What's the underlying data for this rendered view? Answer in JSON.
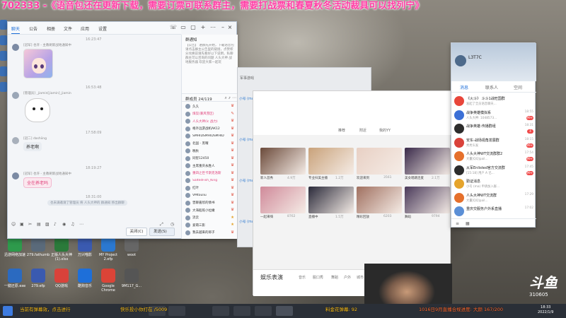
{
  "overlay": {
    "banner": "702333 -《语音包还在更新下载，需要订票可联系群主，需要打战票和春夏秋冬活动裁具可以找列宁》"
  },
  "qq_window": {
    "tabs": [
      "聊天",
      "公告",
      "相册",
      "文件",
      "应用",
      "设置"
    ],
    "messages": [
      {
        "time": "16:23:47",
        "sender": "[冠军] 也许 - 主教刷新战地通知中",
        "type": "sticker-anime"
      },
      {
        "time": "16:53:48",
        "sender": "[管理员] _jiamin[jiamin]_jiamin",
        "type": "sticker-bun"
      },
      {
        "time": "17:58:09",
        "sender": "[冠二] dashiing",
        "text": "养老啊"
      },
      {
        "time": "18:19:27",
        "sender": "[冠军] 也许 - 主教刷新战地通知中",
        "text": "全在养老吗"
      }
    ],
    "sys_time": "18:31:00",
    "system_notice": "也未满邀请了管理员 将 人头大神的 群通知 移出群聊",
    "close_label": "关闭(C)",
    "send_label": "发送(S)",
    "notice_title": "群通知",
    "notice_text": "【公告】 进群先开始，下载语音包请点击群主公告里的链接，点赞积分兑换前请先看好以下说明，私聊群主可以咨询的问题 人头大神 战地服务器 欢迎大家一起玩",
    "members_title": "群成员 24/119",
    "members": [
      {
        "name": "久久",
        "flag": "♛",
        "color": "#333"
      },
      {
        "name": "煤炭(暴风雪区)",
        "flag": "✎",
        "color": "#e0407a"
      },
      {
        "name": "人头大神(lc 战力)",
        "flag": "♛",
        "color": "#e0407a"
      },
      {
        "name": "格外远游战机AK12",
        "flag": "♛",
        "color": "#333"
      },
      {
        "name": "SMHIDSMHIDSMHID",
        "flag": "♛",
        "color": "#333"
      },
      {
        "name": "北国 - 黑曜",
        "flag": "♛",
        "color": "#333"
      },
      {
        "name": "晚秋",
        "flag": "♛",
        "color": "#333"
      },
      {
        "name": "同智12450",
        "flag": "♛",
        "color": "#333"
      },
      {
        "name": "主席重庆永胜人",
        "flag": "♛",
        "color": "#333"
      },
      {
        "name": "重四之巨卡斯克洛斯",
        "flag": "♛",
        "color": "#e0407a"
      },
      {
        "name": "SaltedFish_King",
        "flag": "♛",
        "color": "#e0407a"
      },
      {
        "name": "红叶",
        "flag": "♛",
        "color": "#333"
      },
      {
        "name": "VMtouliu",
        "flag": "♛",
        "color": "#333"
      },
      {
        "name": "曾聊嘉欣的情书",
        "flag": "♛",
        "color": "#333"
      },
      {
        "name": "大海船舵小拉嫩",
        "flag": "♛",
        "color": "#333"
      },
      {
        "name": "流云",
        "flag": "★",
        "color": "#333"
      },
      {
        "name": "爱萌三影",
        "flag": "★",
        "color": "#333"
      },
      {
        "name": "我去越来的郎子",
        "flag": "♛",
        "color": "#333"
      }
    ]
  },
  "mid_window": {
    "title": "军事游戏",
    "rows": [
      {
        "name": "小号 (ma)",
        "text": "申请加入群 人头大神BF无损群",
        "detail": "群号: 这是一个什么群? 答案: 战争游戏 人头大神",
        "status": "由于管理员处理"
      },
      {
        "name": "小号 (ma)",
        "text": "申请加入群 人头大神BF无损群",
        "detail": "群号: 这是一个什么群? 答案: 人头大神 BF 交流群",
        "status": "由于管理员处理"
      },
      {
        "name": "小号 (ma)",
        "text": "申请加入群 人头大神Xmod (示范)",
        "detail": "群号: 这是一个什么群? 答案: 从军乐营群",
        "status": "由于管理员处理"
      },
      {
        "name": "小号 (ma)",
        "text": "申请加入群 人头大神BF无损群",
        "detail": "",
        "status": ""
      }
    ]
  },
  "video_site": {
    "tabs": [
      "推荐",
      "附近",
      "我的YY"
    ],
    "thumbs": [
      {
        "caption": "新人首秀",
        "views": "4.9万"
      },
      {
        "caption": "专业扫美主播",
        "views": "1.2万"
      },
      {
        "caption": "欢迎来到",
        "views": "3561"
      },
      {
        "caption": "美女唱跳连麦",
        "views": "2.1万"
      },
      {
        "caption": "一起来嗨",
        "views": "8762"
      },
      {
        "caption": "直播中",
        "views": "1.5万"
      },
      {
        "caption": "精彩回放",
        "views": "6203"
      },
      {
        "caption": "舞蹈",
        "views": "9794"
      }
    ],
    "footer_title": "娱乐表演",
    "footer_tabs": [
      "音乐",
      "脱口秀",
      "舞蹈",
      "户外",
      "城市"
    ]
  },
  "chat_list": {
    "nickname": "L3T7C",
    "tabs": [
      "消息",
      "联系人",
      "空间"
    ],
    "items": [
      {
        "name": "《火斗》 斗斗1战旺国群",
        "sub": "发起了全员语音聊天...",
        "time": "",
        "badge": "",
        "color": "#e8463b"
      },
      {
        "name": "战争英雄模拟系",
        "sub": "人头大神: 1048573...",
        "time": "18:55",
        "badge": "99+",
        "color": "#3b6fd6"
      },
      {
        "name": "战争英雄-传播群组",
        "sub": "",
        "time": "18:31",
        "badge": "4",
        "color": "#2c2c2c"
      },
      {
        "name": "安东-战场视角发展群",
        "sub": "秀秀头发",
        "time": "18:15",
        "badge": "99+",
        "color": "#d9423a"
      },
      {
        "name": "人头大神WT交流群群2",
        "sub": "大量[QQ]pail...",
        "time": "17:54",
        "badge": "99+",
        "color": "#e5702c"
      },
      {
        "name": "从军Enlisted官方交流群",
        "sub": "[15:18] 用户 A 已...",
        "time": "17:45",
        "badge": "99+",
        "color": "#2c2c2c"
      },
      {
        "name": "勤证消息",
        "sub": "小号 (ma) 申请加入群...",
        "time": "",
        "badge": "",
        "color": "#e5a42c"
      },
      {
        "name": "人头大神WT交流群",
        "sub": "大量[QQ]pail...",
        "time": "17:29",
        "badge": "",
        "color": "#e5702c"
      },
      {
        "name": "重庆交服务户外系直播",
        "sub": "",
        "time": "17:02",
        "badge": "",
        "color": "#5b8fd6"
      }
    ]
  },
  "brand": {
    "name": "斗鱼",
    "room": "310605"
  },
  "taskbar": {
    "ticker_1": "当前有弹幕效，点击进行",
    "ticker_2": "快乐投小你打在 /5009",
    "ticker_3": "料金花弹幕: 92",
    "ticker_4": "1016日9月直播合规进度: 大颜 167/200",
    "date": "2022/1/9",
    "time": "18:33"
  },
  "desktop_icons": [
    {
      "label": "迅游网络加速",
      "color": "#2e9a4c"
    },
    {
      "label": "279.fathumb",
      "color": "#5a6a7a"
    },
    {
      "label": "正版人头大神(1).xlsx",
      "color": "#2a7a3a"
    },
    {
      "label": "万兴喵影",
      "color": "#3a5ab0"
    },
    {
      "label": "MY Project 2.efp",
      "color": "#2b78d0"
    },
    {
      "label": "woot",
      "color": "#666"
    },
    {
      "label": "一键还原.exe",
      "color": "#2b6ac0"
    },
    {
      "label": "279.efp",
      "color": "#3a5ab0"
    },
    {
      "label": "QQ游戏",
      "color": "#d9423a"
    },
    {
      "label": "酷狗音乐",
      "color": "#1e6fd9"
    },
    {
      "label": "Google Chrome",
      "color": "#db4437"
    },
    {
      "label": "9M117_G...",
      "color": "#555"
    }
  ]
}
